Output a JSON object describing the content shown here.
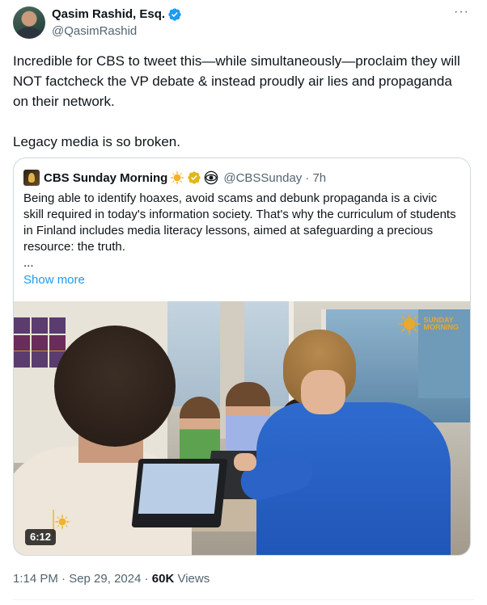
{
  "author": {
    "name": "Qasim Rashid, Esq.",
    "handle": "@QasimRashid"
  },
  "tweet": {
    "paragraph1": "Incredible for CBS to tweet this—while simultaneously—proclaim they will NOT factcheck the VP debate & instead proudly air lies and propaganda on their network.",
    "paragraph2": "Legacy media is so broken."
  },
  "quoted": {
    "name": "CBS Sunday Morning",
    "handle": "@CBSSunday",
    "time": "· 7h",
    "text": "Being able to identify hoaxes, avoid scams and debunk propaganda is a civic skill required in today's information society. That's why the curriculum of students in Finland includes media literacy lessons, aimed at safeguarding a precious resource: the truth.",
    "ellipsis": "...",
    "show_more": "Show more",
    "video": {
      "duration": "6:12",
      "watermark_line1": "SUNDAY",
      "watermark_line2": "MORNING"
    }
  },
  "meta": {
    "timestamp": "1:14 PM · Sep 29, 2024 · ",
    "views_count": "60K",
    "views_label": " Views"
  },
  "icons": {
    "more": "more-icon",
    "verified": "verified-badge-icon"
  },
  "colors": {
    "verified_blue": "#1d9bf0",
    "link_blue": "#1d9bf0",
    "gold": "#e7a92e"
  }
}
